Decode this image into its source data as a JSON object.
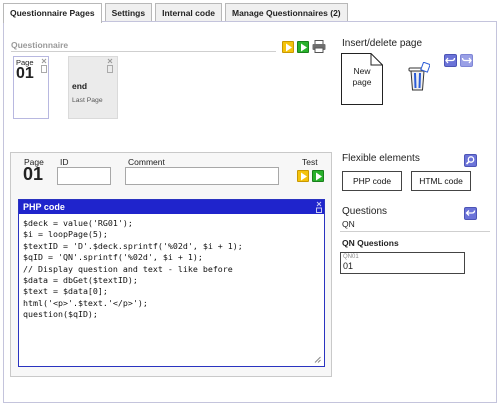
{
  "tabs": [
    {
      "label": "Questionnaire Pages",
      "active": true
    },
    {
      "label": "Settings"
    },
    {
      "label": "Internal code"
    },
    {
      "label": "Manage Questionnaires (2)"
    }
  ],
  "pages_panel": {
    "label": "Questionnaire",
    "cards": [
      {
        "page_label": "Page",
        "number": "01"
      },
      {
        "title": "end",
        "subtitle": "Last Page"
      }
    ]
  },
  "insert_delete": {
    "title": "Insert/delete page",
    "new_page_label": "New page"
  },
  "editor": {
    "page_label": "Page",
    "page_number": "01",
    "id_label": "ID",
    "id_value": "",
    "comment_label": "Comment",
    "comment_value": "",
    "test_label": "Test",
    "php_title": "PHP code",
    "code": "$deck = value('RG01');\n$i = loopPage(5);\n$textID = 'D'.$deck.sprintf('%02d', $i + 1);\n$qID = 'QN'.sprintf('%02d', $i + 1);\n// Display question and text - like before\n$data = dbGet($textID);\n$text = $data[0];\nhtml('<p>'.$text.'</p>');\nquestion($qID);"
  },
  "flexible": {
    "title": "Flexible elements",
    "php_button": "PHP code",
    "html_button": "HTML code"
  },
  "questions": {
    "title": "Questions",
    "code": "QN",
    "group_title": "QN Questions",
    "item_tag": "QN01",
    "item_value": "01"
  },
  "colors": {
    "accent_blue": "#1f24cc",
    "icon_blue": "#6b73d8",
    "test_yellow": "#f4c30c",
    "test_green": "#29b12c"
  }
}
